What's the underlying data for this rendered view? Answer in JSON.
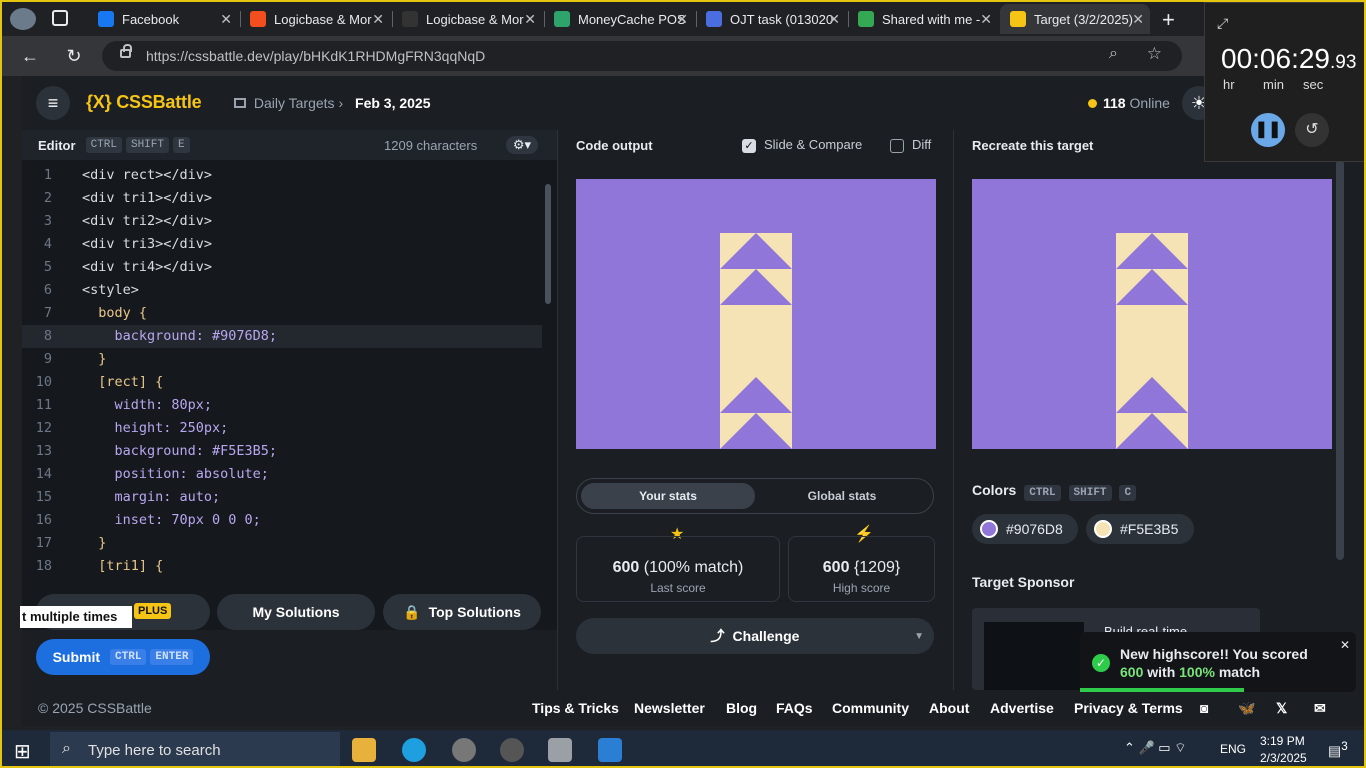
{
  "browser": {
    "tabs": [
      {
        "label": "Facebook",
        "color": "#1877f2"
      },
      {
        "label": "Logicbase & Mor",
        "color": "#f24e1e"
      },
      {
        "label": "Logicbase & Mor",
        "color": "#333333"
      },
      {
        "label": "MoneyCache POS",
        "color": "#2ea36b"
      },
      {
        "label": "OJT task (013020",
        "color": "#4a6ee0"
      },
      {
        "label": "Shared with me -",
        "color": "#34a853"
      },
      {
        "label": "Target (3/2/2025)",
        "color": "#f6c414"
      }
    ],
    "url": "https://cssbattle.dev/play/bHKdK1RHDMgFRN3qqNqD"
  },
  "app": {
    "logo": "{X} CSSBattle",
    "breadcrumb_parent": "Daily Targets",
    "breadcrumb_current": "Feb 3, 2025",
    "online_count": "118",
    "online_label": "Online"
  },
  "editor": {
    "title": "Editor",
    "shortcut": [
      "CTRL",
      "SHIFT",
      "E"
    ],
    "characters": "1209 characters",
    "lines": [
      {
        "n": "1",
        "t": "<div rect></div>"
      },
      {
        "n": "2",
        "t": "<div tri1></div>"
      },
      {
        "n": "3",
        "t": "<div tri2></div>"
      },
      {
        "n": "4",
        "t": "<div tri3></div>"
      },
      {
        "n": "5",
        "t": "<div tri4></div>"
      },
      {
        "n": "6",
        "t": "<style>"
      },
      {
        "n": "7",
        "t": "  body {"
      },
      {
        "n": "8",
        "t": "    background: #9076D8;"
      },
      {
        "n": "9",
        "t": "  }"
      },
      {
        "n": "10",
        "t": "  [rect] {"
      },
      {
        "n": "11",
        "t": "    width: 80px;"
      },
      {
        "n": "12",
        "t": "    height: 250px;"
      },
      {
        "n": "13",
        "t": "    background: #F5E3B5;"
      },
      {
        "n": "14",
        "t": "    position: absolute;"
      },
      {
        "n": "15",
        "t": "    margin: auto;"
      },
      {
        "n": "16",
        "t": "    inset: 70px 0 0 0;"
      },
      {
        "n": "17",
        "t": "  }"
      },
      {
        "n": "18",
        "t": "  [tri1] {"
      }
    ],
    "tooltip": "t multiple times",
    "plus_badge": "PLUS",
    "my_solutions": "My Solutions",
    "top_solutions": "Top Solutions",
    "submit": "Submit",
    "submit_keys": [
      "CTRL",
      "ENTER"
    ]
  },
  "output": {
    "title": "Code output",
    "slide_compare": "Slide & Compare",
    "diff": "Diff",
    "tab_your": "Your stats",
    "tab_global": "Global stats",
    "last_score_value": "600",
    "last_score_match": "(100% match)",
    "last_score_label": "Last score",
    "high_score_value": "600",
    "high_score_chars": "{1209}",
    "high_score_label": "High score",
    "challenge": "Challenge"
  },
  "target": {
    "title": "Recreate this target",
    "colors_title": "Colors",
    "colors_keys": [
      "CTRL",
      "SHIFT",
      "C"
    ],
    "color1": "#9076D8",
    "color2": "#F5E3B5",
    "sponsor_title": "Target Sponsor",
    "sponsor_text": "Build real-time"
  },
  "footer": {
    "copyright": "© 2025 CSSBattle",
    "links": [
      "Tips & Tricks",
      "Newsletter",
      "Blog",
      "FAQs",
      "Community",
      "About",
      "Advertise",
      "Privacy & Terms"
    ]
  },
  "timer": {
    "time": "00:06:29",
    "ms": ".93",
    "hr": "hr",
    "min": "min",
    "sec": "sec"
  },
  "toast": {
    "line1": "New highscore!! You scored",
    "score": "600",
    "with": "with",
    "match": "100%",
    "suffix": "match"
  },
  "taskbar": {
    "search": "Type here to search",
    "lang": "ENG",
    "time": "3:19 PM",
    "date": "2/3/2025",
    "notif": "3"
  }
}
